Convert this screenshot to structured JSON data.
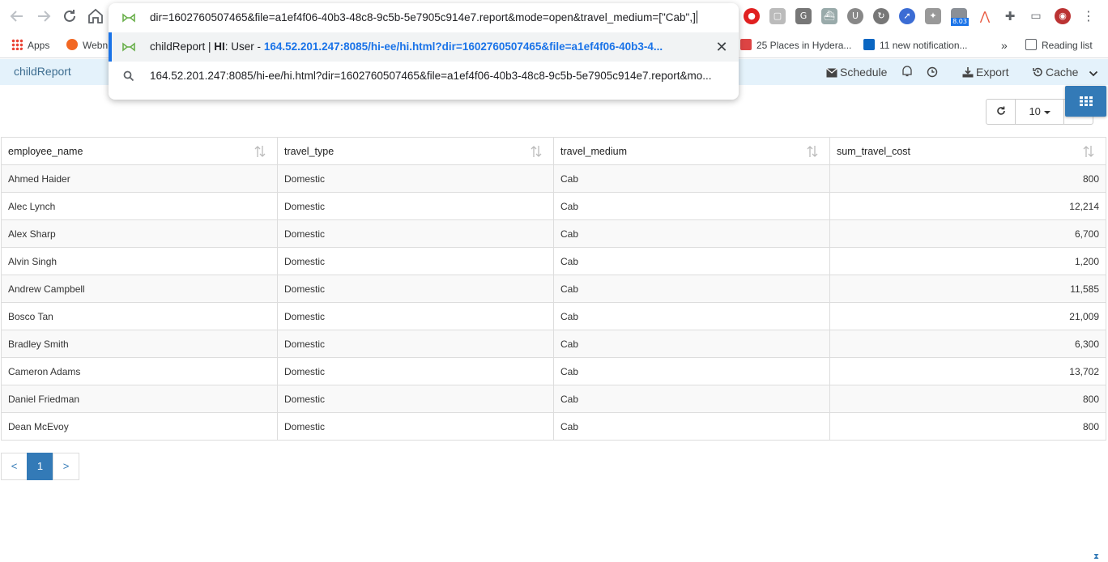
{
  "browser": {
    "omnibox": {
      "typed_text": "dir=1602760507465&file=a1ef4f06-40b3-48c8-9c5b-5e7905c914e7.report&mode=open&travel_medium=[\"Cab\",]",
      "suggestion_title": "childReport | ",
      "suggestion_brand": "HI",
      "suggestion_user": ": User - ",
      "suggestion_url": "164.52.201.247:8085/hi-ee/hi.html?dir=1602760507465&file=a1ef4f06-40b3-4...",
      "search_suggestion": "164.52.201.247:8085/hi-ee/hi.html?dir=1602760507465&file=a1ef4f06-40b3-48c8-9c5b-5e7905c914e7.report&mo..."
    },
    "extension_badge": "8.03",
    "bookmarks": {
      "apps": "Apps",
      "webmail": "Webn",
      "places": "25 Places in Hydera...",
      "linkedin": "11 new notification...",
      "more": "»",
      "reading_list": "Reading list"
    }
  },
  "app": {
    "title": "childReport",
    "schedule": "Schedule",
    "export": "Export",
    "cache": "Cache"
  },
  "table_toolbar": {
    "page_size": "10"
  },
  "table": {
    "columns": [
      "employee_name",
      "travel_type",
      "travel_medium",
      "sum_travel_cost"
    ],
    "rows": [
      [
        "Ahmed Haider",
        "Domestic",
        "Cab",
        "800"
      ],
      [
        "Alec Lynch",
        "Domestic",
        "Cab",
        "12,214"
      ],
      [
        "Alex Sharp",
        "Domestic",
        "Cab",
        "6,700"
      ],
      [
        "Alvin Singh",
        "Domestic",
        "Cab",
        "1,200"
      ],
      [
        "Andrew Campbell",
        "Domestic",
        "Cab",
        "11,585"
      ],
      [
        "Bosco Tan",
        "Domestic",
        "Cab",
        "21,009"
      ],
      [
        "Bradley Smith",
        "Domestic",
        "Cab",
        "6,300"
      ],
      [
        "Cameron Adams",
        "Domestic",
        "Cab",
        "13,702"
      ],
      [
        "Daniel Friedman",
        "Domestic",
        "Cab",
        "800"
      ],
      [
        "Dean McEvoy",
        "Domestic",
        "Cab",
        "800"
      ]
    ]
  },
  "pagination": {
    "prev": "<",
    "current": "1",
    "next": ">"
  },
  "colors": {
    "header_bg": "#e4f2fb",
    "accent": "#337ab7",
    "title": "#3d6d90"
  }
}
